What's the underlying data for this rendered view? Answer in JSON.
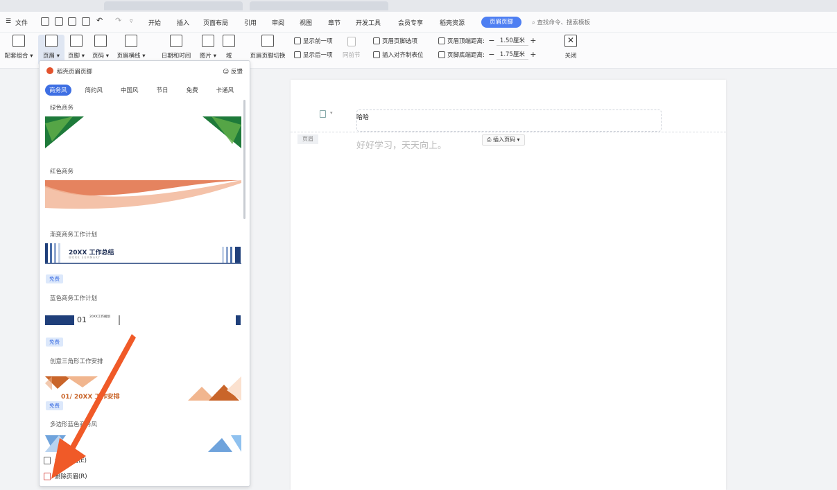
{
  "menubar": {
    "items": [
      "文件",
      "开始",
      "插入",
      "页面布局",
      "引用",
      "审阅",
      "视图",
      "章节",
      "开发工具",
      "会员专享",
      "稻壳资源"
    ],
    "active_tab": "页眉页脚",
    "search_placeholder": "查找命令、搜索模板"
  },
  "ribbon": {
    "buttons": [
      {
        "label": "配套组合 ▾"
      },
      {
        "label": "页眉 ▾"
      },
      {
        "label": "页脚 ▾"
      },
      {
        "label": "页码 ▾"
      },
      {
        "label": "页眉横线 ▾"
      },
      {
        "label": "日期和时间"
      },
      {
        "label": "图片 ▾"
      },
      {
        "label": "域"
      },
      {
        "label": "页眉页脚切换"
      }
    ],
    "show_prev": "显示前一项",
    "show_next": "显示后一项",
    "same_as_prev": "同前节",
    "hf_options": "页眉页脚选项",
    "insert_align_tab": "插入对齐制表位",
    "header_top_label": "页眉顶端距离:",
    "header_top_value": "1.50厘米",
    "footer_bottom_label": "页脚底端距离:",
    "footer_bottom_value": "1.75厘米",
    "close": "关闭"
  },
  "panel": {
    "title": "稻壳页眉页脚",
    "feedback": "反馈",
    "tabs": [
      "商务风",
      "简约风",
      "中国风",
      "节日",
      "免费",
      "卡通风"
    ],
    "active_tab_index": 0,
    "sections": [
      {
        "name": "绿色商务"
      },
      {
        "name": "红色商务"
      },
      {
        "name": "渐变商务工作计划",
        "tile_text": "20XX 工作总结",
        "tile_sub": "WORK SUMMARY",
        "badge": "免费"
      },
      {
        "name": "蓝色商务工作计划",
        "tile_text": "01",
        "tile_sub": "20XX工作规划",
        "badge": "免费"
      },
      {
        "name": "创意三角形工作安排",
        "tile_text": "01/ 20XX  工作安排",
        "badge": "免费"
      },
      {
        "name": "多边形蓝色商务风"
      }
    ],
    "footer_edit": "编辑页眉(E)",
    "footer_delete": "删除页眉(R)"
  },
  "document": {
    "header_text": "哈哈",
    "page_tag": "页眉",
    "body_text": "好好学习，天天向上。",
    "insert_page_number": "插入页码 ▾"
  },
  "colors": {
    "accent": "#4e7ff2",
    "arrow": "#f05a28",
    "green": "#1e7a3a",
    "orange": "#e88a5a",
    "navy": "#1f3f7a"
  }
}
